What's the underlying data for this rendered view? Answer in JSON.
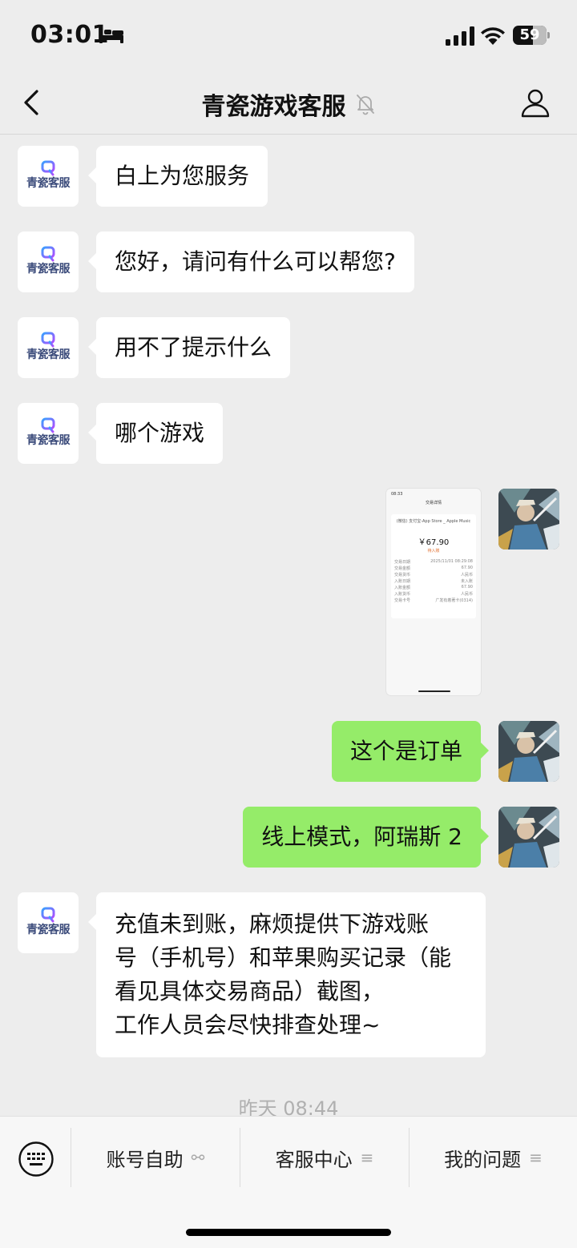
{
  "status_bar": {
    "time": "03:01",
    "battery": "59"
  },
  "header": {
    "title": "青瓷游戏客服"
  },
  "avatars": {
    "cs_label": "青瓷客服"
  },
  "messages": [
    {
      "side": "left",
      "text": "白上为您服务"
    },
    {
      "side": "left",
      "text": "您好，请问有什么可以帮您?"
    },
    {
      "side": "left",
      "text": "用不了提示什么"
    },
    {
      "side": "left",
      "text": "哪个游戏"
    },
    {
      "side": "right",
      "type": "image"
    },
    {
      "side": "right",
      "text": "这个是订单"
    },
    {
      "side": "right",
      "text": "线上模式，阿瑞斯 2"
    },
    {
      "side": "left",
      "lines": [
        "充值未到账，麻烦提供下游戏账",
        "号（手机号）和苹果购买记录（能",
        "看见具体交易商品）截图，",
        "工作人员会尽快排查处理~"
      ]
    }
  ],
  "screenshot": {
    "time": "08:33",
    "title": "交易详情",
    "desc": "(微信) 支付宝-App Store _ Apple Music",
    "amount": "￥67.90",
    "status": "待入账",
    "rows": [
      [
        "交易日期",
        "2025/11/01 08:29:08"
      ],
      [
        "交易金额",
        "67.90"
      ],
      [
        "交易货币",
        "人民币"
      ],
      [
        "入账日期",
        "未入账"
      ],
      [
        "入账金额",
        "67.90"
      ],
      [
        "入账货币",
        "人民币"
      ],
      [
        "交易卡号",
        "广发有着著卡(0314)"
      ]
    ]
  },
  "timestamp": "昨天 08:44",
  "bottom_menu": [
    {
      "label": "账号自助",
      "icon": "link-icon"
    },
    {
      "label": "客服中心",
      "icon": "menu-lines-icon"
    },
    {
      "label": "我的问题",
      "icon": "menu-lines-icon"
    }
  ],
  "colors": {
    "sent_bubble": "#95ec69",
    "received_bubble": "#ffffff",
    "background": "#ededed"
  }
}
